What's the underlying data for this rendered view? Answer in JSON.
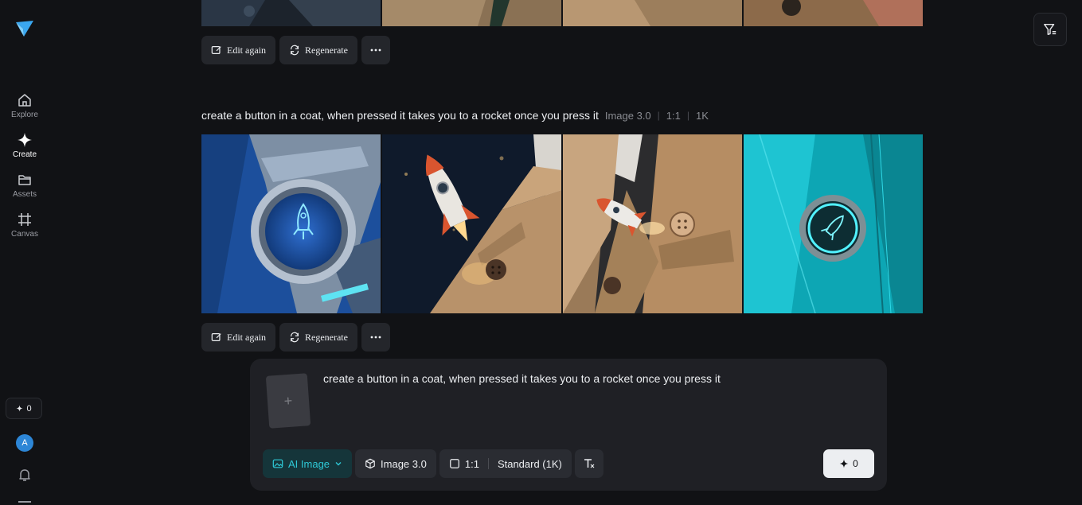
{
  "sidebar": {
    "nav": [
      {
        "label": "Explore",
        "icon": "home-icon"
      },
      {
        "label": "Create",
        "icon": "sparkle-icon",
        "active": true
      },
      {
        "label": "Assets",
        "icon": "folder-icon"
      },
      {
        "label": "Canvas",
        "icon": "canvas-icon"
      }
    ],
    "credits": "0",
    "avatar_initial": "A"
  },
  "history": [
    {
      "actions": {
        "edit": "Edit again",
        "regenerate": "Regenerate"
      }
    },
    {
      "prompt": "create a button in a coat, when pressed it takes you to a rocket once you press it",
      "model": "Image 3.0",
      "ratio": "1:1",
      "resolution": "1K",
      "actions": {
        "edit": "Edit again",
        "regenerate": "Regenerate"
      }
    }
  ],
  "composer": {
    "text": "create a button in a coat, when pressed it takes you to a rocket once you press it",
    "mode": "AI Image",
    "model": "Image 3.0",
    "ratio": "1:1",
    "quality": "Standard (1K)",
    "generate_cost": "0"
  },
  "colors": {
    "accent": "#2ec8d6",
    "avatar": "#2d86d6",
    "background": "#111215"
  }
}
